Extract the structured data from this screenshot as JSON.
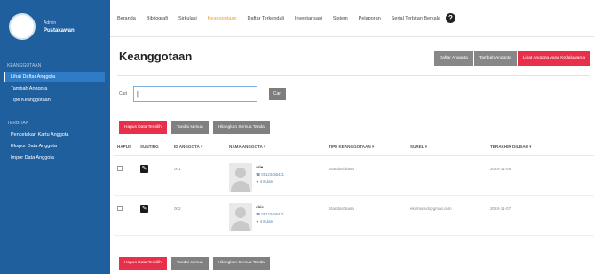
{
  "sidebar": {
    "role": "Admin",
    "username": "Pustakawan",
    "section1": "KEANGGOTAAN",
    "items1": [
      "Lihat Daftar Anggota",
      "Tambah Anggota",
      "Tipe Keanggotaan"
    ],
    "section2": "TERBITAN",
    "items2": [
      "Pencetakan Kartu Anggota",
      "Ekspor Data Anggota",
      "Impor Data Anggota"
    ]
  },
  "topnav": {
    "links": [
      "Beranda",
      "Bibliografi",
      "Sirkulasi",
      "Keanggotaan",
      "Daftar Terkendali",
      "Inventarisasi",
      "Sistem",
      "Pelaporan",
      "Serial Terbitan Berkala"
    ],
    "help_icon": "question-circle-icon",
    "help_glyph": "?"
  },
  "page": {
    "title": "Keanggotaan",
    "tabs": [
      "Daftar Anggota",
      "Tambah Anggota",
      "Lihat Anggota yang Kedaluwarsa"
    ]
  },
  "search": {
    "label": "Cari",
    "value": "|",
    "button": "Cari"
  },
  "actions": {
    "delete": "Hapus Data Terpilih",
    "check_all": "Tandai semua",
    "uncheck_all": "Hilangkan Semua Tanda"
  },
  "table": {
    "headers": [
      "HAPUS",
      "SUNTING",
      "ID ANGGOTA ▾",
      "NAMA ANGGOTA ▾",
      "TIPE KEANGGOTAAN ▾",
      "SUREL ▾",
      "TERAKHIR DIUBAH ▾"
    ],
    "rows": [
      {
        "id": "001",
        "name": "arie",
        "phone": "☎ 08123456421",
        "extra": "★ 4 Bulan",
        "type": "Standar/Biasa",
        "email": "",
        "updated": "2024-11-05"
      },
      {
        "id": "002",
        "name": "ekie",
        "phone": "☎ 08123456421",
        "extra": "★ 4 Bulan",
        "type": "Standar/Biasa",
        "email": "ekiehamid@gmail.com",
        "updated": "2024-11-07"
      }
    ]
  },
  "colors": {
    "sidebar": "#1f5f9e",
    "accent_red": "#e8304a",
    "grey_button": "#808080",
    "active_nav": "#e8a33a"
  }
}
